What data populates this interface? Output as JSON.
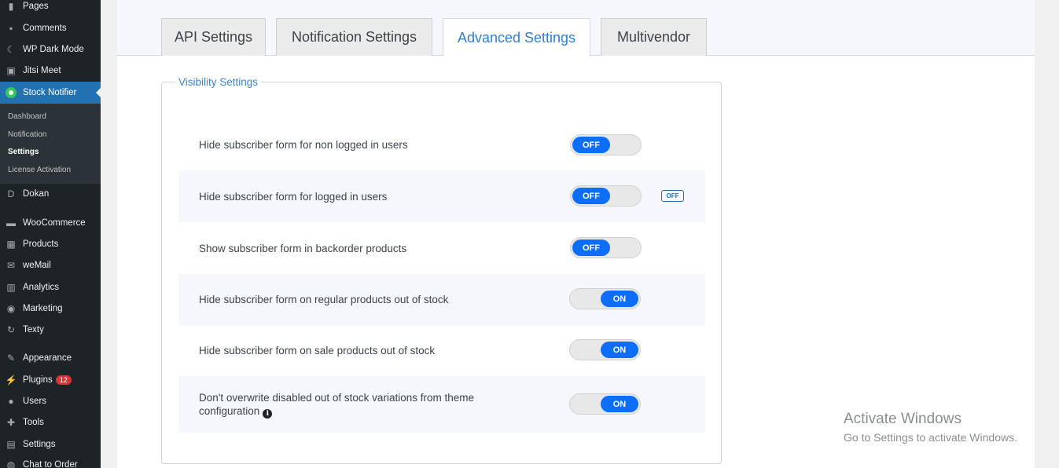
{
  "sidebar": {
    "items": [
      {
        "label": "Pages",
        "icon": "pages-icon",
        "glyph": "▮"
      },
      {
        "label": "Comments",
        "icon": "comments-icon",
        "glyph": "▪"
      },
      {
        "label": "WP Dark Mode",
        "icon": "moon-icon",
        "glyph": "☾"
      },
      {
        "label": "Jitsi Meet",
        "icon": "video-icon",
        "glyph": "▣"
      },
      {
        "label": "Stock Notifier",
        "icon": "stock-notifier-logo-icon",
        "glyph": ""
      },
      {
        "label": "Dokan",
        "icon": "dokan-icon",
        "glyph": "D"
      },
      {
        "label": "WooCommerce",
        "icon": "woocommerce-icon",
        "glyph": "▬"
      },
      {
        "label": "Products",
        "icon": "products-icon",
        "glyph": "▦"
      },
      {
        "label": "weMail",
        "icon": "email-icon",
        "glyph": "✉"
      },
      {
        "label": "Analytics",
        "icon": "bar-chart-icon",
        "glyph": "▥"
      },
      {
        "label": "Marketing",
        "icon": "megaphone-icon",
        "glyph": "◉"
      },
      {
        "label": "Texty",
        "icon": "texty-icon",
        "glyph": "↻"
      },
      {
        "label": "Appearance",
        "icon": "paintbrush-icon",
        "glyph": "✎"
      },
      {
        "label": "Plugins",
        "icon": "plugin-icon",
        "glyph": "⚡"
      },
      {
        "label": "Users",
        "icon": "user-icon",
        "glyph": "●"
      },
      {
        "label": "Tools",
        "icon": "wrench-icon",
        "glyph": "✚"
      },
      {
        "label": "Settings",
        "icon": "settings-icon",
        "glyph": "▤"
      },
      {
        "label": "Chat to Order",
        "icon": "chat-icon",
        "glyph": "◍"
      }
    ],
    "plugins_badge": "12",
    "submenu": [
      "Dashboard",
      "Notification",
      "Settings",
      "License Activation"
    ]
  },
  "tabs": [
    "API Settings",
    "Notification Settings",
    "Advanced Settings",
    "Multivendor"
  ],
  "active_tab": "Advanced Settings",
  "section": {
    "legend": "Visibility Settings",
    "rows": [
      {
        "label": "Hide subscriber form for non logged in users",
        "state": "OFF"
      },
      {
        "label": "Hide subscriber form for logged in users",
        "state": "OFF",
        "extra_badge": "OFF"
      },
      {
        "label": "Show subscriber form in backorder products",
        "state": "OFF"
      },
      {
        "label": "Hide subscriber form on regular products out of stock",
        "state": "ON"
      },
      {
        "label": "Hide subscriber form on sale products out of stock",
        "state": "ON"
      },
      {
        "label": "Don't overwrite disabled out of stock variations from theme configuration",
        "state": "ON",
        "info_icon": "i"
      }
    ]
  },
  "watermark": {
    "title": "Activate Windows",
    "subtitle": "Go to Settings to activate Windows."
  },
  "colors": {
    "sidebar_bg": "#1d2327",
    "active_menu": "#2271b1",
    "toggle_knob": "#0d6efd",
    "active_tab_text": "#2e7ed8"
  }
}
